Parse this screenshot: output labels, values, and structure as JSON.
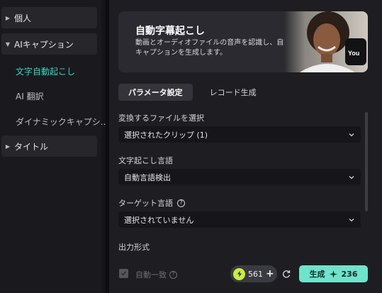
{
  "sidebar": {
    "groups": [
      {
        "label": "個人"
      },
      {
        "label": "AIキャプション"
      },
      {
        "label": "タイトル"
      }
    ],
    "items": [
      {
        "label": "文字自動起こし"
      },
      {
        "label": "AI 翻訳"
      },
      {
        "label": "ダイナミックキャプシ..."
      }
    ]
  },
  "banner": {
    "title": "自動字幕起こし",
    "description": "動画とオーディオファイルの音声を認識し、自動キャプションを生成します。",
    "photo_overlay": "You"
  },
  "tabs": [
    {
      "label": "パラメータ設定"
    },
    {
      "label": "レコード生成"
    }
  ],
  "fields": {
    "file": {
      "label": "変換するファイルを選択",
      "value": "選択されたクリップ (1)"
    },
    "language": {
      "label": "文字起こし言語",
      "value": "自動言語検出"
    },
    "target": {
      "label": "ターゲット言語",
      "value": "選択されていません"
    },
    "output": {
      "label": "出力形式"
    }
  },
  "footer": {
    "auto_match_label": "自動一致",
    "credits": "561",
    "generate_label": "生成",
    "generate_cost": "236"
  },
  "colors": {
    "accent": "#33d7c0",
    "button": "#6fe3cc",
    "credit": "#c7ef3e"
  }
}
